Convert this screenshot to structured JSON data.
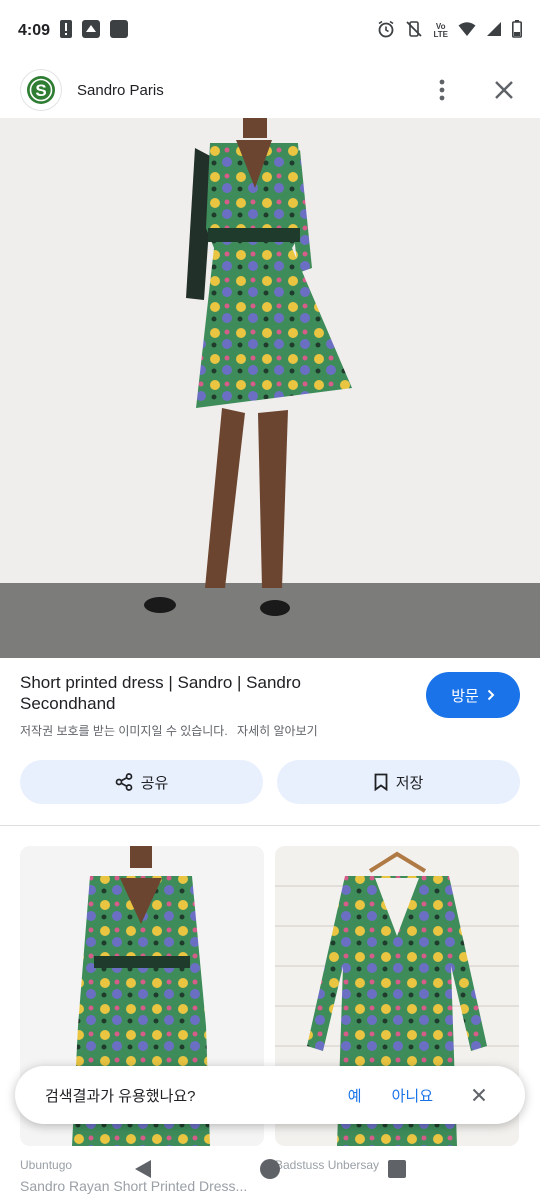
{
  "status_bar": {
    "time": "4:09",
    "volte_top": "Vo",
    "volte_bottom": "LTE"
  },
  "header": {
    "site_name": "Sandro Paris",
    "logo_letter": "S",
    "logo_color": "#2e7d32"
  },
  "result": {
    "title": "Short printed dress | Sandro | Sandro Secondhand",
    "copyright_note": "저작권 보호를 받는 이미지일 수 있습니다.",
    "learn_more": "자세히 알아보기",
    "visit_label": "방문"
  },
  "actions": {
    "share_label": "공유",
    "save_label": "저장"
  },
  "related": [
    {
      "source": "Ubuntugo",
      "title": "Sandro Rayan Short Printed Dress..."
    },
    {
      "source": "Badstuss Unbersay",
      "title": ""
    }
  ],
  "feedback": {
    "question": "검색결과가 유용했나요?",
    "yes_label": "예",
    "no_label": "아니요"
  },
  "colors": {
    "accent": "#1a73e8",
    "pill_bg": "#e8f0fe"
  }
}
